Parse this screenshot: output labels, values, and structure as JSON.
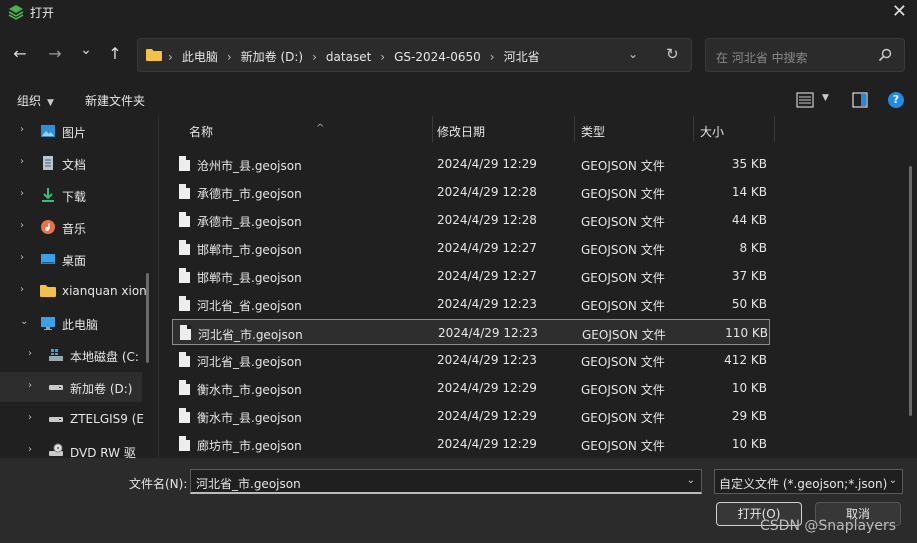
{
  "window": {
    "title": "打开",
    "close": "✕"
  },
  "nav": {
    "back": "←",
    "forward": "→",
    "recent": "⌄",
    "up": "↑"
  },
  "address": {
    "crumbs": [
      "此电脑",
      "新加卷 (D:)",
      "dataset",
      "GS-2024-0650",
      "河北省"
    ],
    "separator": "›",
    "dropdown": "⌄",
    "refresh": "↻"
  },
  "search": {
    "placeholder": "在 河北省 中搜索"
  },
  "toolbar": {
    "organize": "组织",
    "new_folder": "新建文件夹",
    "help": "?"
  },
  "sidebar": {
    "items": [
      {
        "label": "图片",
        "icon": "pictures-icon"
      },
      {
        "label": "文档",
        "icon": "documents-icon"
      },
      {
        "label": "下载",
        "icon": "downloads-icon"
      },
      {
        "label": "音乐",
        "icon": "music-icon"
      },
      {
        "label": "桌面",
        "icon": "desktop-icon"
      },
      {
        "label": "xianquan xion",
        "icon": "folder-icon"
      },
      {
        "label": "此电脑",
        "icon": "computer-icon"
      },
      {
        "label": "本地磁盘 (C:",
        "icon": "drive-icon"
      },
      {
        "label": "新加卷 (D:)",
        "icon": "drive-icon"
      },
      {
        "label": "ZTELGIS9 (E",
        "icon": "drive-icon"
      },
      {
        "label": "DVD RW 驱",
        "icon": "dvd-icon"
      }
    ]
  },
  "columns": {
    "name": "名称",
    "date": "修改日期",
    "type": "类型",
    "size": "大小"
  },
  "files": [
    {
      "name": "沧州市_县.geojson",
      "date": "2024/4/29 12:29",
      "type": "GEOJSON 文件",
      "size": "35 KB"
    },
    {
      "name": "承德市_市.geojson",
      "date": "2024/4/29 12:28",
      "type": "GEOJSON 文件",
      "size": "14 KB"
    },
    {
      "name": "承德市_县.geojson",
      "date": "2024/4/29 12:28",
      "type": "GEOJSON 文件",
      "size": "44 KB"
    },
    {
      "name": "邯郸市_市.geojson",
      "date": "2024/4/29 12:27",
      "type": "GEOJSON 文件",
      "size": "8 KB"
    },
    {
      "name": "邯郸市_县.geojson",
      "date": "2024/4/29 12:27",
      "type": "GEOJSON 文件",
      "size": "37 KB"
    },
    {
      "name": "河北省_省.geojson",
      "date": "2024/4/29 12:23",
      "type": "GEOJSON 文件",
      "size": "50 KB"
    },
    {
      "name": "河北省_市.geojson",
      "date": "2024/4/29 12:23",
      "type": "GEOJSON 文件",
      "size": "110 KB"
    },
    {
      "name": "河北省_县.geojson",
      "date": "2024/4/29 12:23",
      "type": "GEOJSON 文件",
      "size": "412 KB"
    },
    {
      "name": "衡水市_市.geojson",
      "date": "2024/4/29 12:29",
      "type": "GEOJSON 文件",
      "size": "10 KB"
    },
    {
      "name": "衡水市_县.geojson",
      "date": "2024/4/29 12:29",
      "type": "GEOJSON 文件",
      "size": "29 KB"
    },
    {
      "name": "廊坊市_市.geojson",
      "date": "2024/4/29 12:29",
      "type": "GEOJSON 文件",
      "size": "10 KB"
    }
  ],
  "bottom": {
    "filename_label": "文件名(N):",
    "filename_value": "河北省_市.geojson",
    "filter_value": "自定义文件 (*.geojson;*.json)",
    "open_button": "打开(O)",
    "cancel_button": "取消"
  },
  "watermark": "CSDN @Snaplayers",
  "colors": {
    "accent": "#1e8be6",
    "folder": "#f2c14b",
    "background": "#202020"
  }
}
